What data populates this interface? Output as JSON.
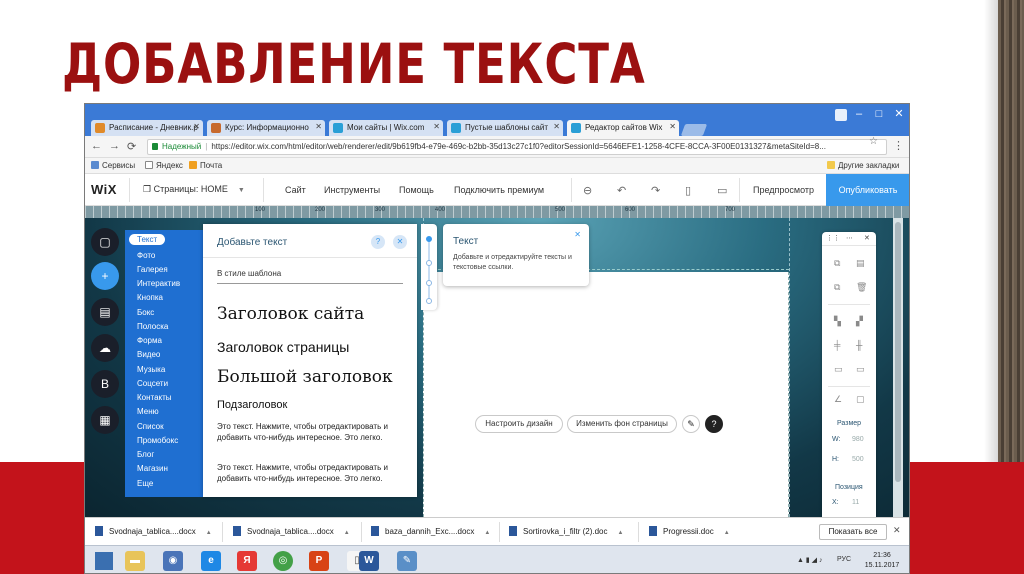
{
  "slide": {
    "title": "ДОБАВЛЕНИЕ ТЕКСТА",
    "accent_color": "#c3131b",
    "title_color": "#9b1010"
  },
  "browser": {
    "tabs": [
      {
        "label": "Расписание - Дневник.р",
        "icon": "diary-icon"
      },
      {
        "label": "Курс: Информационно",
        "icon": "course-icon"
      },
      {
        "label": "Мои сайты | Wix.com",
        "icon": "wix-icon"
      },
      {
        "label": "Пустые шаблоны сайт",
        "icon": "wix-icon"
      },
      {
        "label": "Редактор сайтов Wix",
        "icon": "wix-icon",
        "active": true
      }
    ],
    "secure_label": "Надежный",
    "url": "https://editor.wix.com/html/editor/web/renderer/edit/9b619fb4-e79e-469c-b2bb-35d13c27c1f0?editorSessionId=5646EFE1-1258-4CFE-8CCA-3F00E0131327&metaSiteId=8...",
    "bookmarks": [
      {
        "label": "Сервисы",
        "icon": "apps-icon"
      },
      {
        "label": "Яндекс",
        "icon": "yandex-icon"
      },
      {
        "label": "Почта",
        "icon": "mail-icon"
      }
    ],
    "other_bookmarks": "Другие закладки"
  },
  "wix": {
    "logo": "WiX",
    "pages_label": "Страницы: HOME",
    "menu": [
      "Сайт",
      "Инструменты",
      "Помощь",
      "Подключить премиум"
    ],
    "preview": "Предпросмотр",
    "publish": "Опубликовать",
    "ruler_numbers": [
      "100",
      "200",
      "300",
      "400",
      "500",
      "600",
      "700"
    ],
    "categories": [
      "Текст",
      "Фото",
      "Галерея",
      "Интерактив",
      "Кнопка",
      "Бокс",
      "Полоска",
      "Форма",
      "Видео",
      "Музыка",
      "Соцсети",
      "Контакты",
      "Меню",
      "Список",
      "Промобокс",
      "Блог",
      "Магазин",
      "Еще"
    ],
    "selected_category": "Текст",
    "add_panel": {
      "title": "Добавьте текст",
      "section": "В стиле шаблона",
      "site_title": "Заголовок сайта",
      "page_title": "Заголовок страницы",
      "big_title": "Большой заголовок",
      "subtitle": "Подзаголовок",
      "paragraph1": "Это текст. Нажмите, чтобы отредактировать и добавить что-нибудь интересное. Это легко.",
      "paragraph2": "Это текст. Нажмите, чтобы отредактировать и добавить что-нибудь интересное. Это легко."
    },
    "tooltip": {
      "title": "Текст",
      "body": "Добавьте и отредактируйте тексты и текстовые ссылки."
    },
    "page_buttons": {
      "design": "Настроить дизайн",
      "background": "Изменить фон страницы"
    },
    "right_panel": {
      "size_label": "Размер",
      "w_label": "W:",
      "w_value": "980",
      "h_label": "H:",
      "h_value": "500",
      "position_label": "Позиция",
      "x_label": "X:",
      "x_value": "11",
      "y_label": "Y:",
      "y_value": "111"
    }
  },
  "downloads": {
    "items": [
      "Svodnaja_tablica....docx",
      "Svodnaja_tablica....docx",
      "baza_dannih_Exc....docx",
      "Sortirovka_i_filtr (2).doc",
      "Progressii.doc"
    ],
    "show_all": "Показать все"
  },
  "taskbar": {
    "lang": "РУС",
    "time": "21:36",
    "date": "15.11.2017"
  }
}
